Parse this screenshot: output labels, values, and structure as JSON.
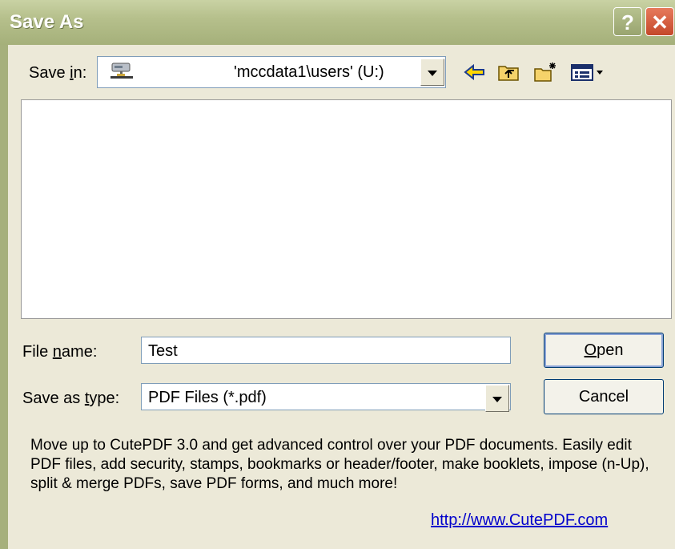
{
  "window": {
    "title": "Save As",
    "help_glyph": "?",
    "close_glyph": "✕"
  },
  "save_in": {
    "label_pre": "Save ",
    "label_key": "i",
    "label_post": "n:",
    "value": "'mccdata1\\users' (U:)",
    "drive_icon": "network-drive-icon"
  },
  "toolbar": {
    "back_icon": "back-arrow-icon",
    "up_icon": "up-folder-icon",
    "new_folder_icon": "new-folder-icon",
    "views_icon": "views-menu-icon"
  },
  "file_name": {
    "label_pre": "File ",
    "label_key": "n",
    "label_post": "ame:",
    "value": "Test"
  },
  "save_as_type": {
    "label_pre": "Save as ",
    "label_key": "t",
    "label_post": "ype:",
    "value": "PDF Files (*.pdf)"
  },
  "buttons": {
    "open_key": "O",
    "open_rest": "pen",
    "cancel": "Cancel"
  },
  "promo": {
    "text": "Move up to CutePDF 3.0 and get advanced control over your PDF documents. Easily edit PDF files, add security, stamps, bookmarks or header/footer, make booklets, impose (n-Up), split & merge PDFs, save PDF forms, and much more!",
    "link": "http://www.CutePDF.com"
  }
}
